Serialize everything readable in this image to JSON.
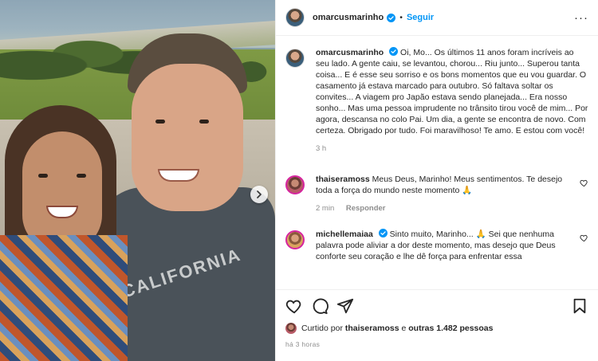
{
  "post": {
    "author": "omarcusmarinho",
    "follow_label": "Seguir",
    "separator": "•",
    "more_label": "···"
  },
  "caption": {
    "author": "omarcusmarinho",
    "text": "Oi, Mo... Os últimos 11 anos foram incríveis ao seu lado. A gente caiu, se levantou, chorou... Riu junto... Superou tanta coisa... E é esse seu sorriso e os bons momentos que eu vou guardar. O casamento já estava marcado para outubro. Só faltava soltar os convites... A viagem pro Japão estava sendo planejada... Era nosso sonho... Mas uma pessoa imprudente no trânsito tirou você de mim... Por agora, descansa no colo Pai. Um dia, a gente se encontra de novo. Com certeza. Obrigado por tudo. Foi maravilhoso! Te amo. E estou com você!",
    "time": "3 h"
  },
  "comments": [
    {
      "author": "thaiseramoss",
      "text": "Meus Deus, Marinho! Meus sentimentos. Te desejo toda a força do mundo neste momento 🙏",
      "time": "2 min",
      "reply_label": "Responder"
    },
    {
      "author": "michellemaiaa",
      "text": "Sinto muito, Marinho... 🙏 Sei que nenhuma palavra pode aliviar a dor deste momento, mas desejo que Deus conforte seu coração e lhe dê força para enfrentar essa",
      "time": "",
      "reply_label": ""
    }
  ],
  "likes": {
    "prefix": "Curtido por",
    "user": "thaiseramoss",
    "connector": "e",
    "others": "outras 1.482 pessoas"
  },
  "posted_ago": "há 3 horas",
  "photo": {
    "shirt_text": "CALIFORNIA"
  },
  "icons": {
    "verified": "verified-badge-icon",
    "like": "heart-icon",
    "comment": "comment-bubble-icon",
    "share": "paper-plane-icon",
    "save": "bookmark-icon",
    "next": "chevron-right-icon"
  },
  "colors": {
    "accent": "#0095f6",
    "text": "#262626",
    "muted": "#8e8e8e"
  }
}
